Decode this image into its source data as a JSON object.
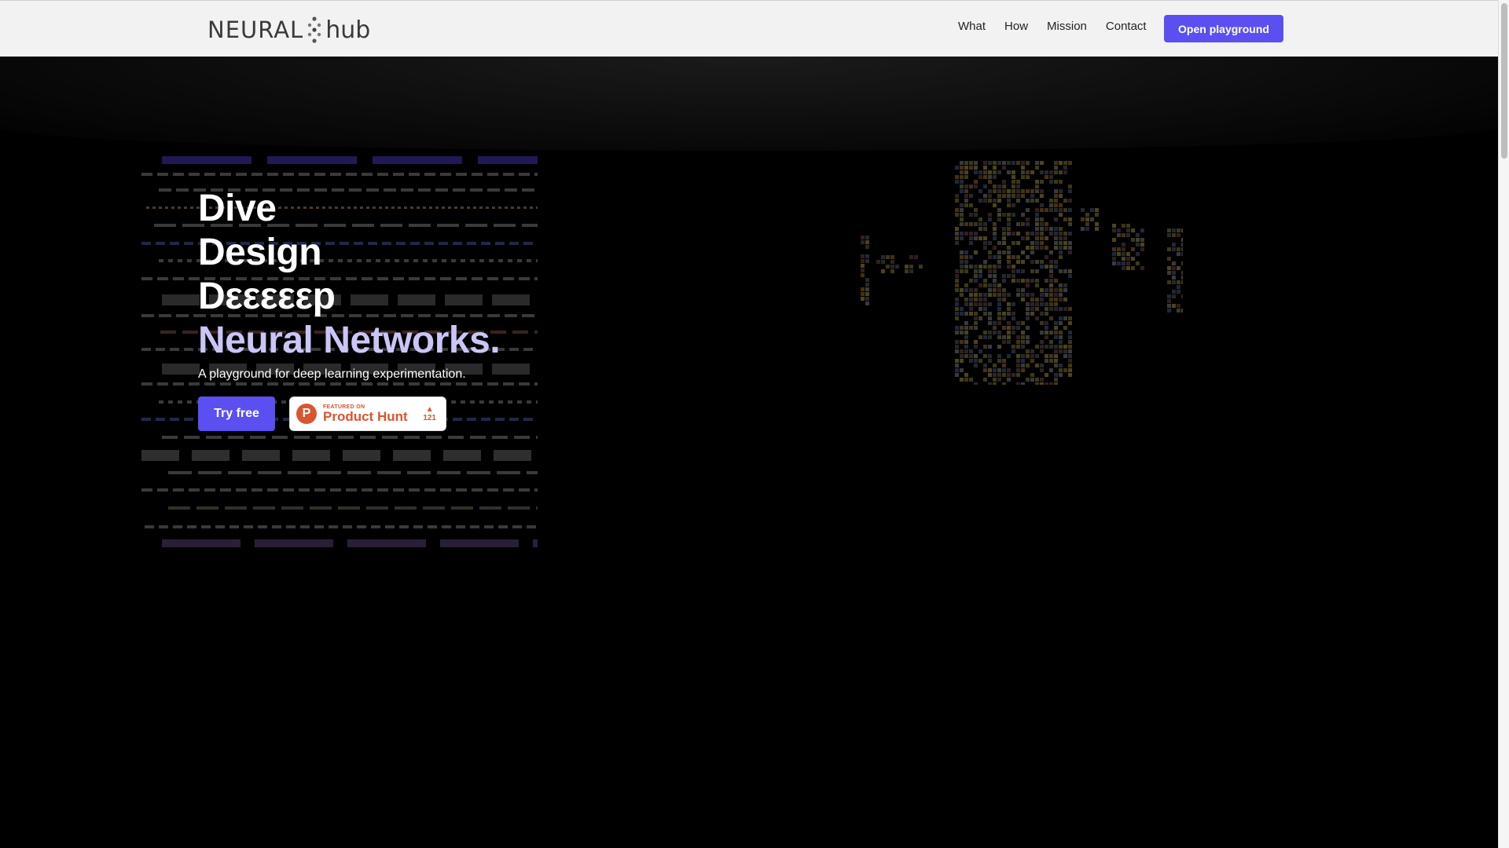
{
  "header": {
    "logo_part1": "NEURAL",
    "logo_part2": "hub",
    "nav": [
      "What",
      "How",
      "Mission",
      "Contact"
    ],
    "cta_label": "Open playground"
  },
  "hero": {
    "lines": [
      "Dive",
      "Design",
      "Dεεεεεp"
    ],
    "accent_line": "Neural Networks.",
    "subtitle": "A playground for deep learning experimentation.",
    "try_label": "Try free",
    "product_hunt": {
      "featured_label": "FEATURED ON",
      "name": "Product Hunt",
      "logo_letter": "P",
      "arrow": "▲",
      "votes": "121"
    }
  },
  "colors": {
    "accent": "#5b4ff2",
    "accent_text": "#c9c6f7",
    "product_hunt": "#da552f"
  }
}
